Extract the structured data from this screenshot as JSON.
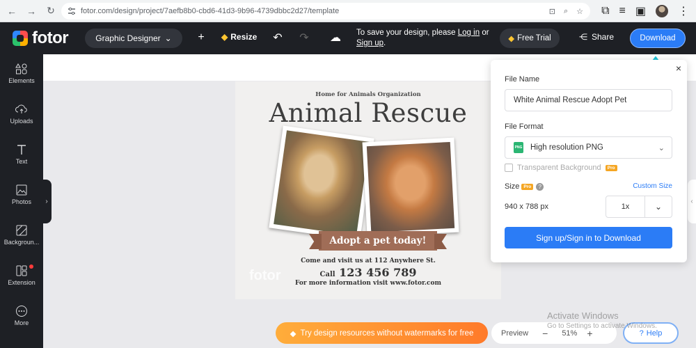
{
  "browser": {
    "url": "fotor.com/design/project/7aefb8b0-cbd6-41d3-9b96-4739dbbc2d27/template"
  },
  "topbar": {
    "logo_text": "fotor",
    "designer_label": "Graphic Designer",
    "resize_label": "Resize",
    "save_msg_prefix": "To save your design, please",
    "login_label": "Log in",
    "or_text": "or",
    "signup_label": "Sign up",
    "period": ".",
    "free_trial_label": "Free Trial",
    "share_label": "Share",
    "download_label": "Download"
  },
  "sidebar": {
    "items": [
      {
        "label": "Elements",
        "icon": "elements-icon"
      },
      {
        "label": "Uploads",
        "icon": "upload-cloud-icon"
      },
      {
        "label": "Text",
        "icon": "text-icon"
      },
      {
        "label": "Photos",
        "icon": "photos-icon"
      },
      {
        "label": "Backgroun...",
        "icon": "background-icon"
      },
      {
        "label": "Extension",
        "icon": "extension-icon"
      },
      {
        "label": "More",
        "icon": "more-icon"
      }
    ]
  },
  "design": {
    "org": "Home for Animals Organization",
    "title": "Animal Rescue",
    "ribbon": "Adopt a pet today!",
    "visit": "Come and visit us at 112 Anywhere St.",
    "call_prefix": "Call",
    "phone": "123 456 789",
    "more_info": "For more information visit www.fotor.com",
    "watermark": "fotor"
  },
  "download_panel": {
    "file_name_label": "File Name",
    "file_name_value": "White Animal Rescue Adopt Pet",
    "file_format_label": "File Format",
    "file_format_value": "High resolution PNG",
    "png_badge": "PNG",
    "transparent_label": "Transparent Background",
    "pro_badge": "Pro",
    "size_label": "Size",
    "custom_size_label": "Custom Size",
    "dimensions": "940 x 788 px",
    "scale_value": "1x",
    "signin_button": "Sign up/Sign in to Download"
  },
  "bottom": {
    "promo_label": "Try design resources without watermarks for free",
    "preview_label": "Preview",
    "zoom_value": "51%",
    "help_label": "Help",
    "activate_title": "Activate Windows",
    "activate_sub": "Go to Settings to activate Windows."
  },
  "colors": {
    "accent": "#2b7cf6",
    "topbar_bg": "#1e2025",
    "promo": "#ff8f32",
    "ribbon": "#a06d57"
  }
}
